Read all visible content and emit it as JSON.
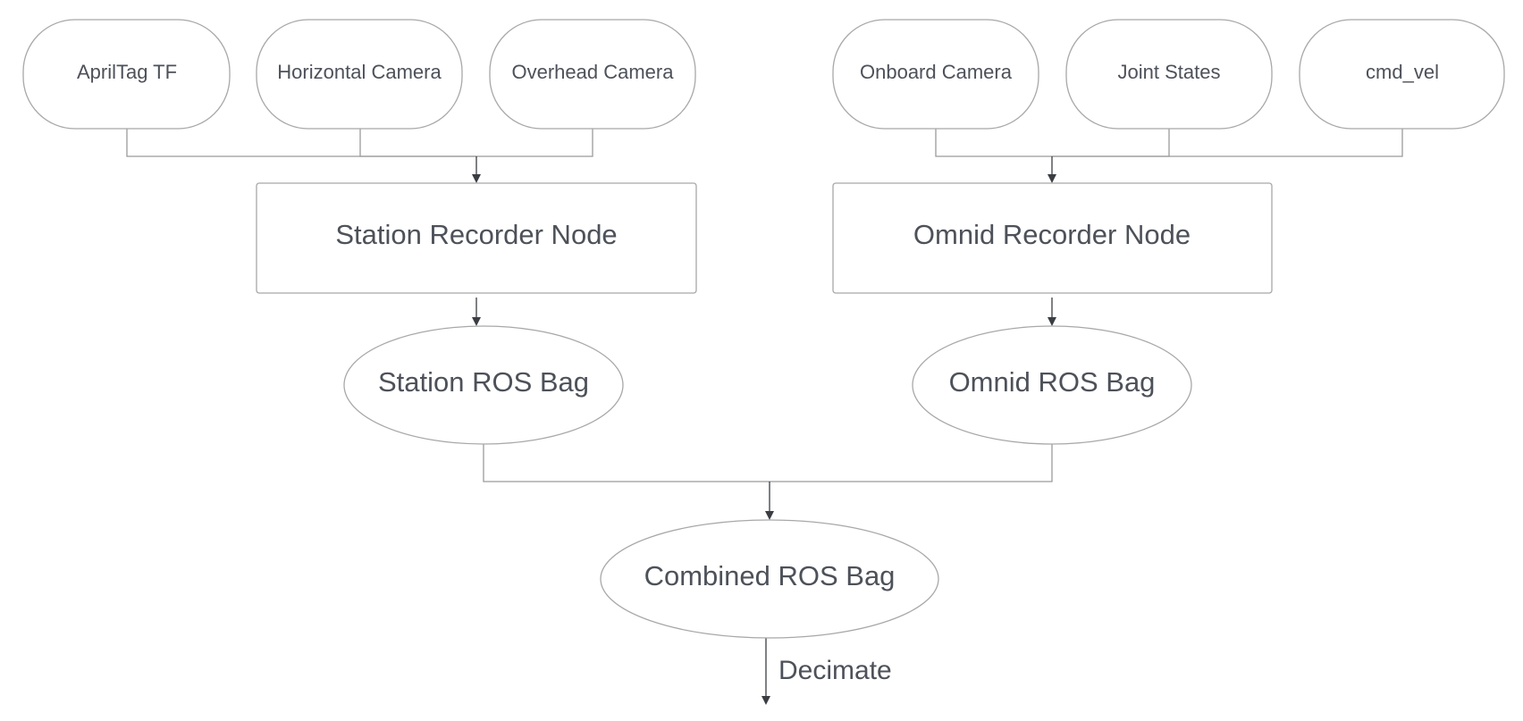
{
  "sources_left": [
    "AprilTag TF",
    "Horizontal Camera",
    "Overhead Camera"
  ],
  "sources_right": [
    "Onboard Camera",
    "Joint States",
    "cmd_vel"
  ],
  "nodes": {
    "station_recorder": "Station Recorder Node",
    "omnid_recorder": "Omnid Recorder Node"
  },
  "bags": {
    "station": "Station ROS Bag",
    "omnid": "Omnid ROS Bag",
    "combined": "Combined ROS Bag"
  },
  "edge_labels": {
    "decimate": "Decimate"
  },
  "colors": {
    "text": "#4d5159",
    "border": "#a8a8a8",
    "arrow": "#3a3d42"
  }
}
